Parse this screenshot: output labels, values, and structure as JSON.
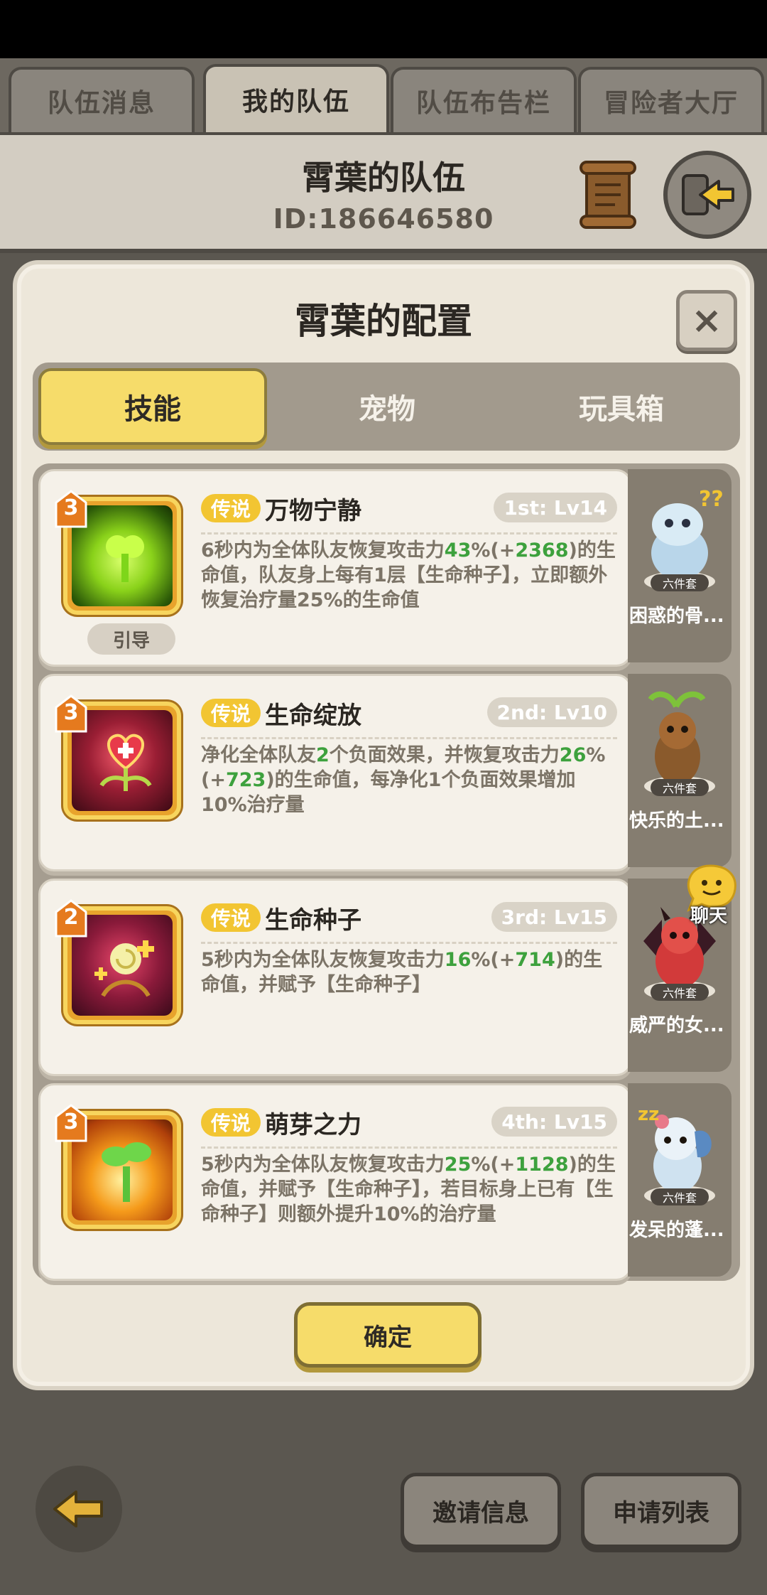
{
  "tabs": [
    {
      "label": "队伍消息"
    },
    {
      "label": "我的队伍"
    },
    {
      "label": "队伍布告栏"
    },
    {
      "label": "冒险者大厅"
    }
  ],
  "header": {
    "title": "霄葉的队伍",
    "id_text": "ID:186646580"
  },
  "modal": {
    "title": "霄葉的配置",
    "close_label": "×",
    "segments": [
      {
        "label": "技能"
      },
      {
        "label": "宠物"
      },
      {
        "label": "玩具箱"
      }
    ],
    "confirm_label": "确定"
  },
  "skills": [
    {
      "level": "3",
      "rarity": "传说",
      "name": "万物宁静",
      "slot": "1st: Lv14",
      "tag": "引导",
      "desc_parts": [
        "6秒内为全体队友恢复攻击力",
        "43",
        "%(+",
        "2368",
        ")的生命值，队友身上每有1层【生命种子】，立即额外恢复治疗量25%的生命值"
      ]
    },
    {
      "level": "3",
      "rarity": "传说",
      "name": "生命绽放",
      "slot": "2nd: Lv10",
      "desc_parts": [
        "净化全体队友",
        "2",
        "个负面效果，并恢复攻击力",
        "26",
        "%(+",
        "723",
        ")的生命值，每净化1个负面效果增加10%治疗量"
      ]
    },
    {
      "level": "2",
      "rarity": "传说",
      "name": "生命种子",
      "slot": "3rd: Lv15",
      "desc_parts": [
        "5秒内为全体队友恢复攻击力",
        "16",
        "%(+",
        "714",
        ")的生命值，并赋予【生命种子】"
      ]
    },
    {
      "level": "3",
      "rarity": "传说",
      "name": "萌芽之力",
      "slot": "4th: Lv15",
      "desc_parts": [
        "5秒内为全体队友恢复攻击力",
        "25",
        "%(+",
        "1128",
        ")的生命值，并赋予【生命种子】，若目标身上已有【生命种子】则额外提升10%的治疗量"
      ]
    }
  ],
  "pets": [
    {
      "set_label": "六件套",
      "name": "困惑的骨..."
    },
    {
      "set_label": "六件套",
      "name": "快乐的土..."
    },
    {
      "set_label": "六件套",
      "name": "威严的女..."
    },
    {
      "set_label": "六件套",
      "name": "发呆的蓬..."
    }
  ],
  "chat": {
    "label": "聊天"
  },
  "bottom": {
    "invite_label": "邀请信息",
    "apply_label": "申请列表"
  },
  "colors": {
    "accent_yellow": "#f6dc6a",
    "legend_gold": "#f2c532",
    "value_green": "#3da13d"
  }
}
